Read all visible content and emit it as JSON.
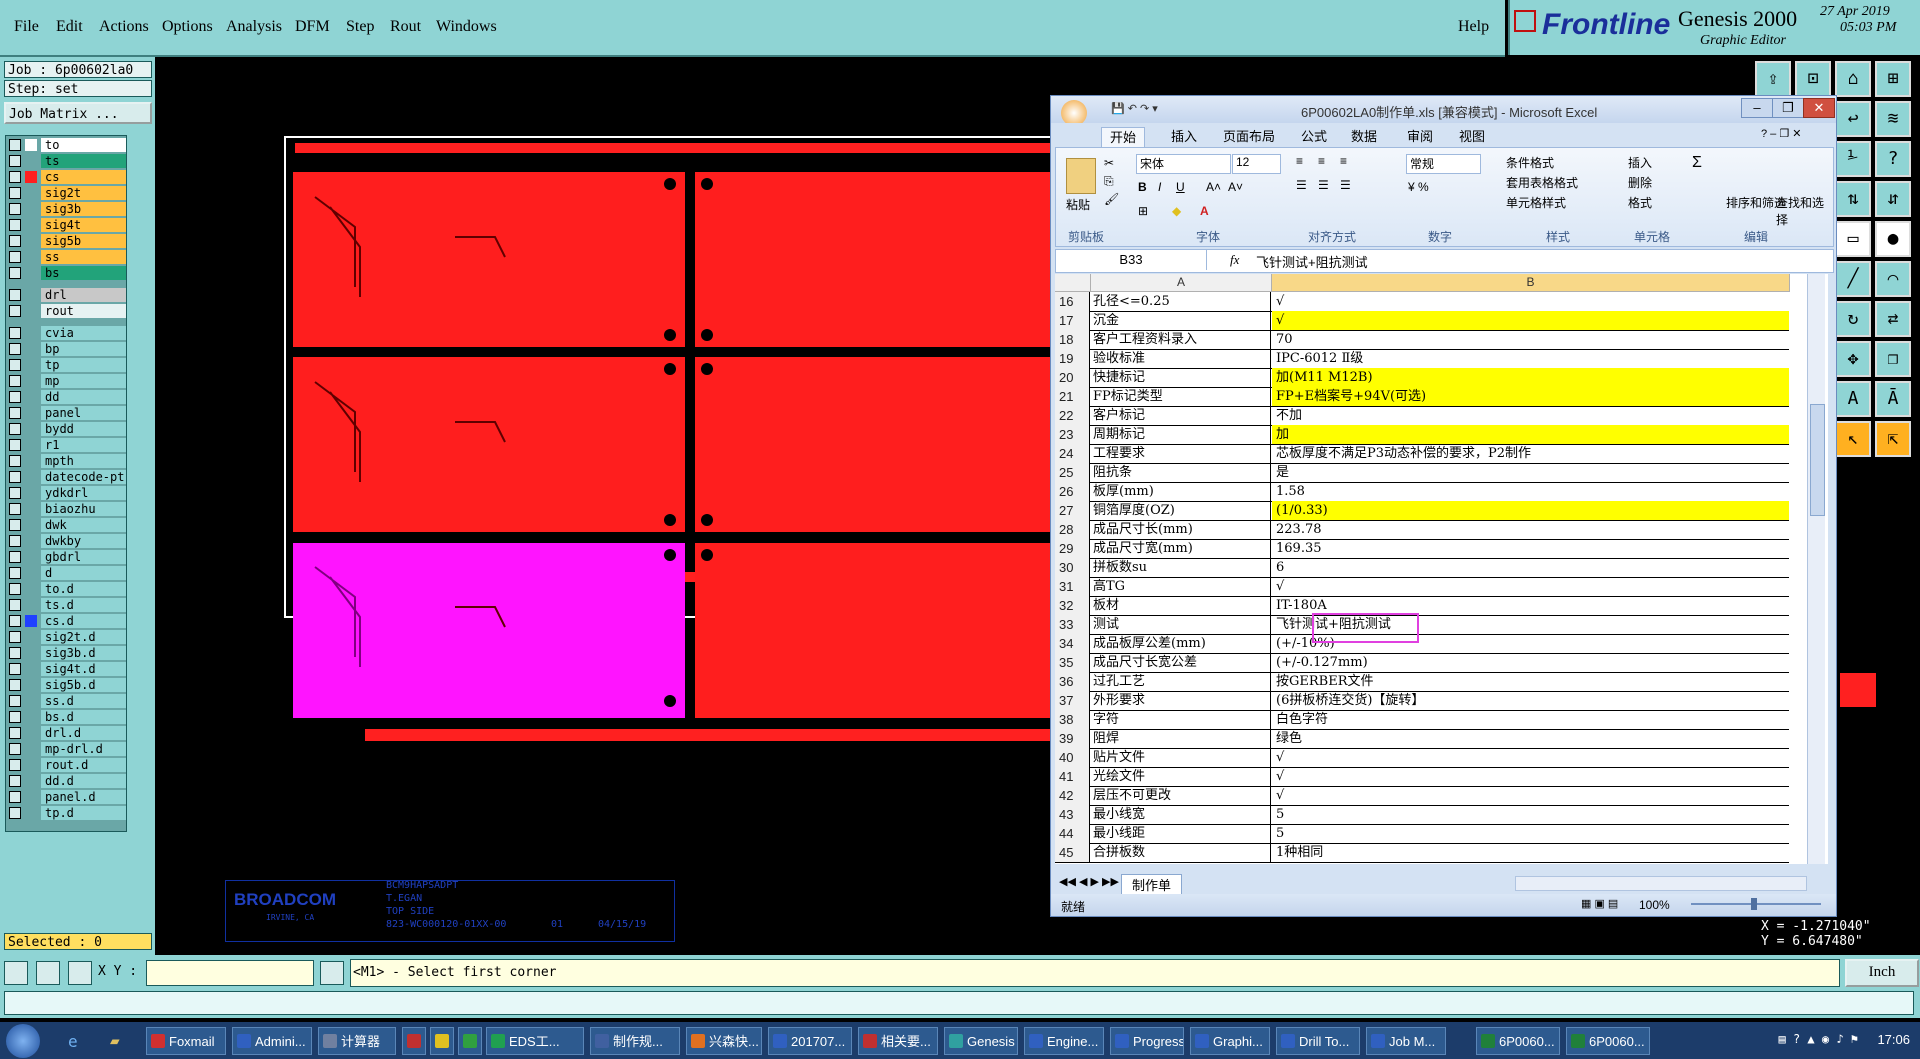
{
  "menubar": {
    "items": [
      "File",
      "Edit",
      "Actions",
      "Options",
      "Analysis",
      "DFM",
      "Step",
      "Rout",
      "Windows"
    ],
    "help": "Help"
  },
  "brand": {
    "logo": "Frontline",
    "product": "Genesis 2000",
    "subtitle": "Graphic Editor",
    "date": "27 Apr 2019",
    "time": "05:03 PM"
  },
  "left": {
    "job": "Job : 6p00602la0",
    "step": "Step: set",
    "matrix_button": "Job Matrix ...",
    "selected": "Selected : 0",
    "layers": [
      {
        "name": "to",
        "color": "#ffffff",
        "marker": "#ffffff"
      },
      {
        "name": "ts",
        "color": "#22a37a",
        "marker": "#6aa7a7"
      },
      {
        "name": "cs",
        "color": "#ffc040",
        "marker": "#ff2020"
      },
      {
        "name": "sig2t",
        "color": "#ffc040",
        "marker": "#6aa7a7"
      },
      {
        "name": "sig3b",
        "color": "#ffc040",
        "marker": "#6aa7a7"
      },
      {
        "name": "sig4t",
        "color": "#ffc040",
        "marker": "#6aa7a7"
      },
      {
        "name": "sig5b",
        "color": "#ffc040",
        "marker": "#6aa7a7"
      },
      {
        "name": "ss",
        "color": "#ffc040",
        "marker": "#6aa7a7"
      },
      {
        "name": "bs",
        "color": "#22a37a",
        "marker": "#6aa7a7"
      },
      {
        "name": "drl",
        "color": "#c8c8c8",
        "marker": "#6aa7a7"
      },
      {
        "name": "rout",
        "color": "#e6f2f2",
        "marker": "#6aa7a7"
      },
      {
        "name": "cvia",
        "color": "#8fd4d4",
        "marker": "#6aa7a7"
      },
      {
        "name": "bp",
        "color": "#8fd4d4",
        "marker": "#6aa7a7"
      },
      {
        "name": "tp",
        "color": "#8fd4d4",
        "marker": "#6aa7a7"
      },
      {
        "name": "mp",
        "color": "#8fd4d4",
        "marker": "#6aa7a7"
      },
      {
        "name": "dd",
        "color": "#8fd4d4",
        "marker": "#6aa7a7"
      },
      {
        "name": "panel",
        "color": "#8fd4d4",
        "marker": "#6aa7a7"
      },
      {
        "name": "bydd",
        "color": "#8fd4d4",
        "marker": "#6aa7a7"
      },
      {
        "name": "r1",
        "color": "#8fd4d4",
        "marker": "#6aa7a7"
      },
      {
        "name": "mpth",
        "color": "#8fd4d4",
        "marker": "#6aa7a7"
      },
      {
        "name": "datecode-pt",
        "color": "#8fd4d4",
        "marker": "#6aa7a7"
      },
      {
        "name": "ydkdrl",
        "color": "#8fd4d4",
        "marker": "#6aa7a7"
      },
      {
        "name": "biaozhu",
        "color": "#8fd4d4",
        "marker": "#6aa7a7"
      },
      {
        "name": "dwk",
        "color": "#8fd4d4",
        "marker": "#6aa7a7"
      },
      {
        "name": "dwkby",
        "color": "#8fd4d4",
        "marker": "#6aa7a7"
      },
      {
        "name": "gbdrl",
        "color": "#8fd4d4",
        "marker": "#6aa7a7"
      },
      {
        "name": "d",
        "color": "#8fd4d4",
        "marker": "#6aa7a7"
      },
      {
        "name": "to.d",
        "color": "#8fd4d4",
        "marker": "#6aa7a7"
      },
      {
        "name": "ts.d",
        "color": "#8fd4d4",
        "marker": "#6aa7a7"
      },
      {
        "name": "cs.d",
        "color": "#8fd4d4",
        "marker": "#2040ff"
      },
      {
        "name": "sig2t.d",
        "color": "#8fd4d4",
        "marker": "#6aa7a7"
      },
      {
        "name": "sig3b.d",
        "color": "#8fd4d4",
        "marker": "#6aa7a7"
      },
      {
        "name": "sig4t.d",
        "color": "#8fd4d4",
        "marker": "#6aa7a7"
      },
      {
        "name": "sig5b.d",
        "color": "#8fd4d4",
        "marker": "#6aa7a7"
      },
      {
        "name": "ss.d",
        "color": "#8fd4d4",
        "marker": "#6aa7a7"
      },
      {
        "name": "bs.d",
        "color": "#8fd4d4",
        "marker": "#6aa7a7"
      },
      {
        "name": "drl.d",
        "color": "#8fd4d4",
        "marker": "#6aa7a7"
      },
      {
        "name": "mp-drl.d",
        "color": "#8fd4d4",
        "marker": "#6aa7a7"
      },
      {
        "name": "rout.d",
        "color": "#8fd4d4",
        "marker": "#6aa7a7"
      },
      {
        "name": "dd.d",
        "color": "#8fd4d4",
        "marker": "#6aa7a7"
      },
      {
        "name": "panel.d",
        "color": "#8fd4d4",
        "marker": "#6aa7a7"
      },
      {
        "name": "tp.d",
        "color": "#8fd4d4",
        "marker": "#6aa7a7"
      }
    ]
  },
  "titleblock": {
    "company": "BROADCOM",
    "location": "IRVINE, CA",
    "part": "BCM9HAPSADPT",
    "by": "T.EGAN",
    "side": "TOP SIDE",
    "number": "823-WC000120-01XX-00",
    "rev": "01",
    "date": "04/15/19"
  },
  "coords": {
    "x": "X = -1.271040\"",
    "y": "Y = 6.647480\""
  },
  "cmd": {
    "xy_label": "X Y :",
    "prompt": "<M1> - Select first corner",
    "units": "Inch"
  },
  "excel": {
    "title": "6P00602LA0制作单.xls [兼容模式] - Microsoft Excel",
    "tabs": [
      "开始",
      "插入",
      "页面布局",
      "公式",
      "数据",
      "审阅",
      "视图"
    ],
    "font_name": "宋体",
    "font_size": "12",
    "number_format": "常规",
    "paste": "粘贴",
    "ribbon_small": [
      "条件格式",
      "套用表格格式",
      "单元格样式",
      "插入",
      "删除",
      "格式",
      "排序和筛选",
      "查找和选择"
    ],
    "groups": [
      "剪贴板",
      "字体",
      "对齐方式",
      "数字",
      "样式",
      "单元格",
      "编辑"
    ],
    "cell_ref": "B33",
    "formula": "飞针测试+阻抗测试",
    "col_a": "A",
    "col_b": "B",
    "rows": [
      {
        "n": "16",
        "a": "孔径<=0.25",
        "b": "√",
        "y": false
      },
      {
        "n": "17",
        "a": "沉金",
        "b": "√",
        "y": true
      },
      {
        "n": "18",
        "a": "客户工程资料录入",
        "b": "70",
        "y": false
      },
      {
        "n": "19",
        "a": "验收标准",
        "b": "IPC-6012 Ⅱ级",
        "y": false
      },
      {
        "n": "20",
        "a": "快捷标记",
        "b": "加(M11 M12B)",
        "y": true
      },
      {
        "n": "21",
        "a": "FP标记类型",
        "b": "FP+E档案号+94V(可选)",
        "y": true
      },
      {
        "n": "22",
        "a": "客户标记",
        "b": "不加",
        "y": false
      },
      {
        "n": "23",
        "a": "周期标记",
        "b": "加",
        "y": true
      },
      {
        "n": "24",
        "a": "工程要求",
        "b": "芯板厚度不满足P3动态补偿的要求，P2制作",
        "y": false
      },
      {
        "n": "25",
        "a": "阻抗条",
        "b": "是",
        "y": false
      },
      {
        "n": "26",
        "a": "板厚(mm)",
        "b": "1.58",
        "y": false
      },
      {
        "n": "27",
        "a": "铜箔厚度(OZ)",
        "b": "(1/0.33)",
        "y": true
      },
      {
        "n": "28",
        "a": "成品尺寸长(mm)",
        "b": "223.78",
        "y": false
      },
      {
        "n": "29",
        "a": "成品尺寸宽(mm)",
        "b": "169.35",
        "y": false
      },
      {
        "n": "30",
        "a": "拼板数su",
        "b": "6",
        "y": false
      },
      {
        "n": "31",
        "a": "高TG",
        "b": "√",
        "y": false
      },
      {
        "n": "32",
        "a": "板材",
        "b": "IT-180A",
        "y": false
      },
      {
        "n": "33",
        "a": "测试",
        "b": "飞针测试+阻抗测试",
        "y": false
      },
      {
        "n": "34",
        "a": "成品板厚公差(mm)",
        "b": "(+/-10%)",
        "y": false
      },
      {
        "n": "35",
        "a": "成品尺寸长宽公差",
        "b": "(+/-0.127mm)",
        "y": false
      },
      {
        "n": "36",
        "a": "过孔工艺",
        "b": "按GERBER文件",
        "y": false
      },
      {
        "n": "37",
        "a": "外形要求",
        "b": "(6拼板桥连交货)【旋转】",
        "y": false
      },
      {
        "n": "38",
        "a": "字符",
        "b": "白色字符",
        "y": false
      },
      {
        "n": "39",
        "a": "阻焊",
        "b": "绿色",
        "y": false
      },
      {
        "n": "40",
        "a": "贴片文件",
        "b": "√",
        "y": false
      },
      {
        "n": "41",
        "a": "光绘文件",
        "b": "√",
        "y": false
      },
      {
        "n": "42",
        "a": "层压不可更改",
        "b": "√",
        "y": false
      },
      {
        "n": "43",
        "a": "最小线宽",
        "b": "5",
        "y": false
      },
      {
        "n": "44",
        "a": "最小线距",
        "b": "5",
        "y": false
      },
      {
        "n": "45",
        "a": "合拼板数",
        "b": "1种相同",
        "y": false
      }
    ],
    "sheet": "制作单",
    "status": "就绪",
    "zoom": "100%"
  },
  "taskbar": {
    "clock": "17:06",
    "items": [
      {
        "label": "Foxmail",
        "color": "#d03030"
      },
      {
        "label": "Admini...",
        "color": "#3060c0"
      },
      {
        "label": "计算器",
        "color": "#7080a0"
      },
      {
        "label": "",
        "color": "#c03030"
      },
      {
        "label": "",
        "color": "#e0c020"
      },
      {
        "label": "",
        "color": "#30a040"
      },
      {
        "label": "EDS工...",
        "color": "#20a050"
      },
      {
        "label": "制作规...",
        "color": "#4060a0"
      },
      {
        "label": "兴森快...",
        "color": "#e07020"
      },
      {
        "label": "201707...",
        "color": "#3060c0"
      },
      {
        "label": "相关要...",
        "color": "#c03030"
      },
      {
        "label": "Genesis",
        "color": "#30a0a0"
      },
      {
        "label": "Engine...",
        "color": "#3060c0"
      },
      {
        "label": "Progress",
        "color": "#3060c0"
      },
      {
        "label": "Graphi...",
        "color": "#3060c0"
      },
      {
        "label": "Drill To...",
        "color": "#3060c0"
      },
      {
        "label": "Job M...",
        "color": "#3060c0"
      },
      {
        "label": "6P0060...",
        "color": "#20803a"
      },
      {
        "label": "6P0060...",
        "color": "#20803a"
      }
    ]
  }
}
